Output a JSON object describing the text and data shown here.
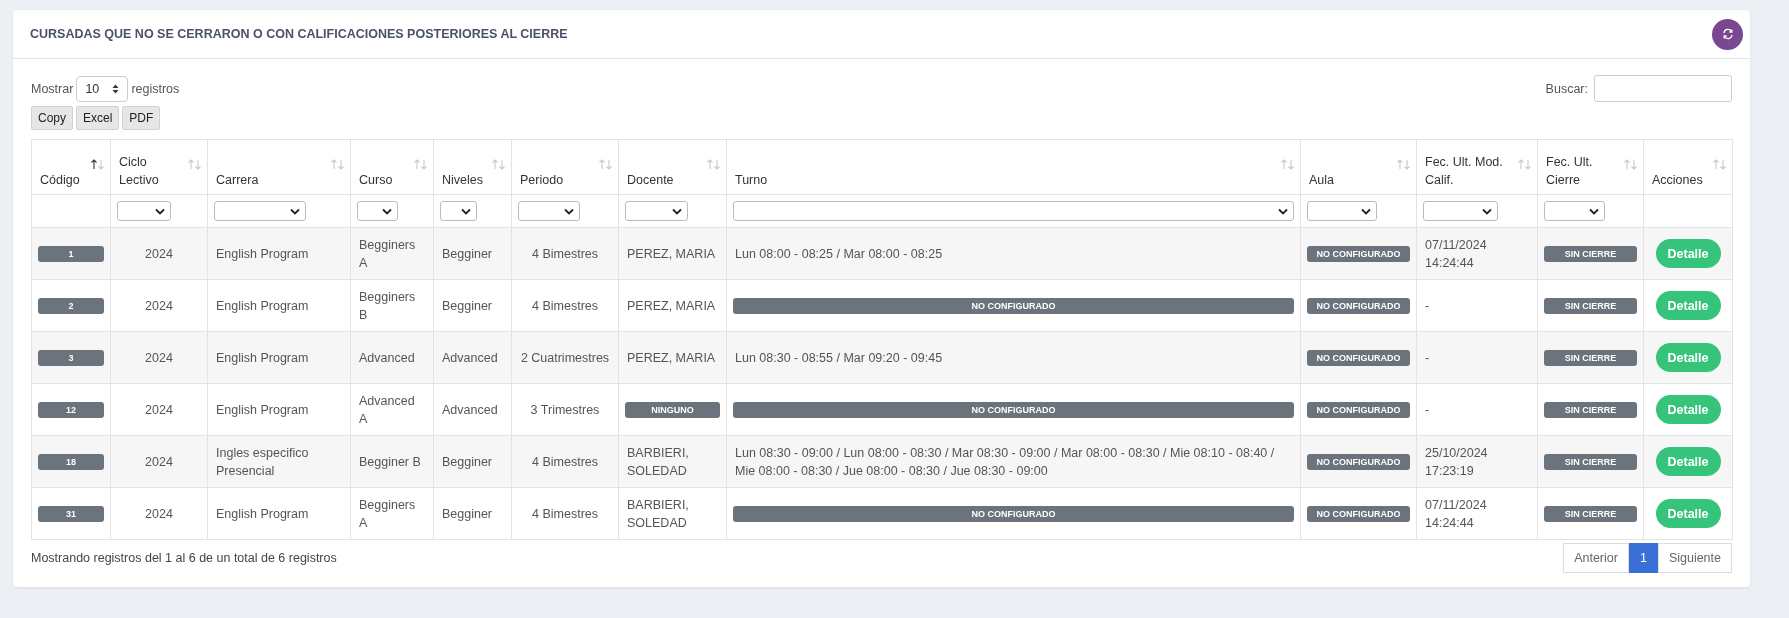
{
  "card": {
    "title": "CURSADAS QUE NO SE CERRARON O CON CALIFICACIONES POSTERIORES AL CIERRE"
  },
  "length_control": {
    "label_before": "Mostrar",
    "value": "10",
    "label_after": "registros"
  },
  "search": {
    "label": "Buscar:"
  },
  "export_buttons": [
    "Copy",
    "Excel",
    "PDF"
  ],
  "table": {
    "columns": [
      {
        "label": "Código",
        "sorted": true,
        "filter": false
      },
      {
        "label": "Ciclo Lectivo",
        "sorted": false,
        "filter": true
      },
      {
        "label": "Carrera",
        "sorted": false,
        "filter": true
      },
      {
        "label": "Curso",
        "sorted": false,
        "filter": true
      },
      {
        "label": "Niveles",
        "sorted": false,
        "filter": true
      },
      {
        "label": "Periodo",
        "sorted": false,
        "filter": true
      },
      {
        "label": "Docente",
        "sorted": false,
        "filter": true
      },
      {
        "label": "Turno",
        "sorted": false,
        "filter": true
      },
      {
        "label": "Aula",
        "sorted": false,
        "filter": true
      },
      {
        "label": "Fec. Ult. Mod. Calif.",
        "sorted": false,
        "filter": true
      },
      {
        "label": "Fec. Ult. Cierre",
        "sorted": false,
        "filter": true
      },
      {
        "label": "Acciones",
        "sorted": false,
        "filter": false
      }
    ],
    "rows": [
      {
        "cells": [
          {
            "kind": "badge",
            "text": "1"
          },
          {
            "kind": "center",
            "text": "2024"
          },
          {
            "kind": "text",
            "text": "English Program"
          },
          {
            "kind": "text",
            "text": "Begginers A"
          },
          {
            "kind": "text",
            "text": "Begginer"
          },
          {
            "kind": "center",
            "text": "4 Bimestres"
          },
          {
            "kind": "text",
            "text": "PEREZ, MARIA"
          },
          {
            "kind": "text",
            "text": "Lun 08:00 - 08:25 / Mar 08:00 - 08:25"
          },
          {
            "kind": "badge",
            "text": "NO CONFIGURADO"
          },
          {
            "kind": "text",
            "text": "07/11/2024 14:24:44"
          },
          {
            "kind": "badge",
            "text": "SIN CIERRE"
          },
          {
            "kind": "button",
            "text": "Detalle"
          }
        ]
      },
      {
        "cells": [
          {
            "kind": "badge",
            "text": "2"
          },
          {
            "kind": "center",
            "text": "2024"
          },
          {
            "kind": "text",
            "text": "English Program"
          },
          {
            "kind": "text",
            "text": "Begginers B"
          },
          {
            "kind": "text",
            "text": "Begginer"
          },
          {
            "kind": "center",
            "text": "4 Bimestres"
          },
          {
            "kind": "text",
            "text": "PEREZ, MARIA"
          },
          {
            "kind": "badge",
            "text": "NO CONFIGURADO"
          },
          {
            "kind": "badge",
            "text": "NO CONFIGURADO"
          },
          {
            "kind": "text",
            "text": "-"
          },
          {
            "kind": "badge",
            "text": "SIN CIERRE"
          },
          {
            "kind": "button",
            "text": "Detalle"
          }
        ]
      },
      {
        "cells": [
          {
            "kind": "badge",
            "text": "3"
          },
          {
            "kind": "center",
            "text": "2024"
          },
          {
            "kind": "text",
            "text": "English Program"
          },
          {
            "kind": "text",
            "text": "Advanced"
          },
          {
            "kind": "text",
            "text": "Advanced"
          },
          {
            "kind": "center",
            "text": "2 Cuatrimestres"
          },
          {
            "kind": "text",
            "text": "PEREZ, MARIA"
          },
          {
            "kind": "text",
            "text": "Lun 08:30 - 08:55 / Mar 09:20 - 09:45"
          },
          {
            "kind": "badge",
            "text": "NO CONFIGURADO"
          },
          {
            "kind": "text",
            "text": "-"
          },
          {
            "kind": "badge",
            "text": "SIN CIERRE"
          },
          {
            "kind": "button",
            "text": "Detalle"
          }
        ]
      },
      {
        "cells": [
          {
            "kind": "badge",
            "text": "12"
          },
          {
            "kind": "center",
            "text": "2024"
          },
          {
            "kind": "text",
            "text": "English Program"
          },
          {
            "kind": "text",
            "text": "Advanced A"
          },
          {
            "kind": "text",
            "text": "Advanced"
          },
          {
            "kind": "center",
            "text": "3 Trimestres"
          },
          {
            "kind": "badge",
            "text": "NINGUNO"
          },
          {
            "kind": "badge",
            "text": "NO CONFIGURADO"
          },
          {
            "kind": "badge",
            "text": "NO CONFIGURADO"
          },
          {
            "kind": "text",
            "text": "-"
          },
          {
            "kind": "badge",
            "text": "SIN CIERRE"
          },
          {
            "kind": "button",
            "text": "Detalle"
          }
        ]
      },
      {
        "cells": [
          {
            "kind": "badge",
            "text": "18"
          },
          {
            "kind": "center",
            "text": "2024"
          },
          {
            "kind": "text",
            "text": "Ingles especifico Presencial"
          },
          {
            "kind": "text",
            "text": "Begginer B"
          },
          {
            "kind": "text",
            "text": "Begginer"
          },
          {
            "kind": "center",
            "text": "4 Bimestres"
          },
          {
            "kind": "text",
            "text": "BARBIERI, SOLEDAD"
          },
          {
            "kind": "text",
            "text": "Lun 08:30 - 09:00 / Lun 08:00 - 08:30 / Mar 08:30 - 09:00 / Mar 08:00 - 08:30 / Mie 08:10 - 08:40 / Mie 08:00 - 08:30 / Jue 08:00 - 08:30 / Jue 08:30 - 09:00"
          },
          {
            "kind": "badge",
            "text": "NO CONFIGURADO"
          },
          {
            "kind": "text",
            "text": "25/10/2024 17:23:19"
          },
          {
            "kind": "badge",
            "text": "SIN CIERRE"
          },
          {
            "kind": "button",
            "text": "Detalle"
          }
        ]
      },
      {
        "cells": [
          {
            "kind": "badge",
            "text": "31"
          },
          {
            "kind": "center",
            "text": "2024"
          },
          {
            "kind": "text",
            "text": "English Program"
          },
          {
            "kind": "text",
            "text": "Begginers A"
          },
          {
            "kind": "text",
            "text": "Begginer"
          },
          {
            "kind": "center",
            "text": "4 Bimestres"
          },
          {
            "kind": "text",
            "text": "BARBIERI, SOLEDAD"
          },
          {
            "kind": "badge",
            "text": "NO CONFIGURADO"
          },
          {
            "kind": "badge",
            "text": "NO CONFIGURADO"
          },
          {
            "kind": "text",
            "text": "07/11/2024 14:24:44"
          },
          {
            "kind": "badge",
            "text": "SIN CIERRE"
          },
          {
            "kind": "button",
            "text": "Detalle"
          }
        ]
      }
    ]
  },
  "info": "Mostrando registros del 1 al 6 de un total de 6 registros",
  "pagination": [
    {
      "label": "Anterior",
      "selected": false
    },
    {
      "label": "1",
      "selected": true
    },
    {
      "label": "Siguiente",
      "selected": false
    }
  ]
}
